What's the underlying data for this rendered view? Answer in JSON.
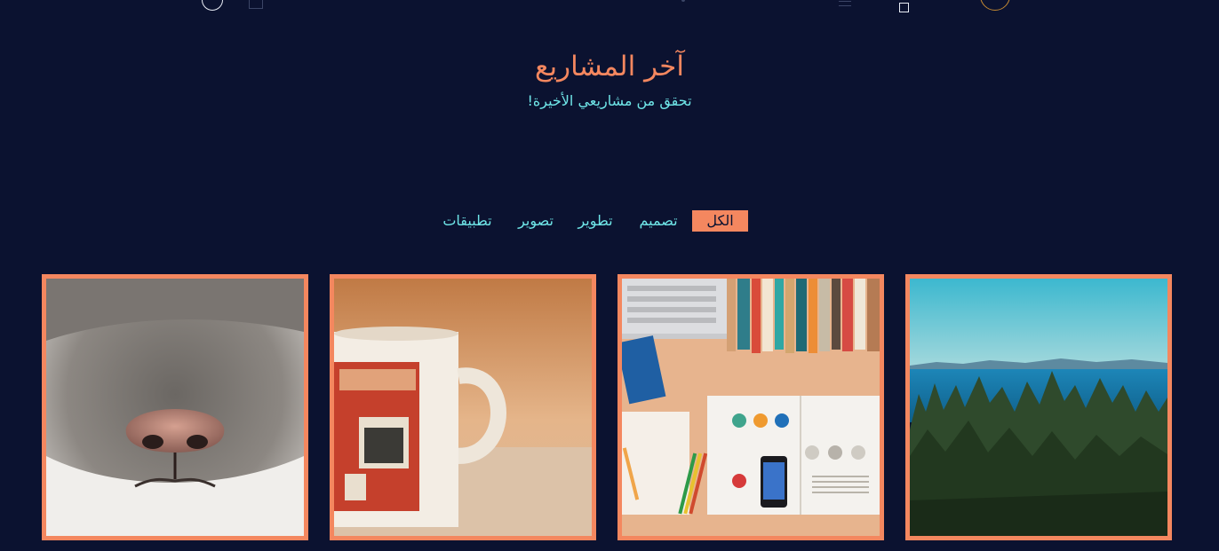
{
  "header": {
    "title": "آخر المشاريع",
    "subtitle": "تحقق من مشاريعي الأخيرة!"
  },
  "filters": [
    {
      "label": "الكل",
      "active": true
    },
    {
      "label": "تصميم",
      "active": false
    },
    {
      "label": "تطوير",
      "active": false
    },
    {
      "label": "تصوير",
      "active": false
    },
    {
      "label": "تطبيقات",
      "active": false
    }
  ],
  "gallery": {
    "items": [
      {
        "subject": "forest-lake-photo"
      },
      {
        "subject": "desk-laptop-books-photo"
      },
      {
        "subject": "coffee-mug-photo"
      },
      {
        "subject": "cat-nose-photo"
      }
    ]
  },
  "colors": {
    "background": "#0b1230",
    "accent": "#f4875f",
    "subtitle": "#6fe6e8"
  }
}
